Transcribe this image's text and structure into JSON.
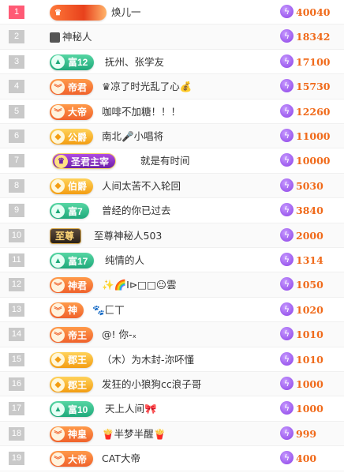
{
  "leaderboard": [
    {
      "rank": "1",
      "badge": {
        "text": "",
        "style": "fire",
        "icon": "crown-icon"
      },
      "name": "焕儿一",
      "score": "40040"
    },
    {
      "rank": "2",
      "badge": null,
      "avatar": "mystery-avatar-icon",
      "name": "神秘人",
      "score": "18342"
    },
    {
      "rank": "3",
      "badge": {
        "text": "富12",
        "style": "green",
        "icon": "triangle-icon"
      },
      "name": "抚州、张学友",
      "score": "17100"
    },
    {
      "rank": "4",
      "badge": {
        "text": "帝君",
        "style": "orange",
        "icon": "chevron-icon"
      },
      "name": "♛凉了时光乱了心💰",
      "score": "15730"
    },
    {
      "rank": "5",
      "badge": {
        "text": "大帝",
        "style": "orange",
        "icon": "chevron-icon"
      },
      "name": "咖啡不加糖！！！",
      "score": "12260"
    },
    {
      "rank": "6",
      "badge": {
        "text": "公爵",
        "style": "gold",
        "icon": "diamond-icon"
      },
      "name": "南北🎤小唱将",
      "score": "11000"
    },
    {
      "rank": "7",
      "badge": {
        "text": "圣君主宰",
        "style": "purple",
        "icon": "crown-icon"
      },
      "name": "就是有时间",
      "score": "10000"
    },
    {
      "rank": "8",
      "badge": {
        "text": "伯爵",
        "style": "gold",
        "icon": "diamond-icon"
      },
      "name": "人间太苦不入轮回",
      "score": "5030"
    },
    {
      "rank": "9",
      "badge": {
        "text": "富7",
        "style": "green",
        "icon": "triangle-icon"
      },
      "name": "曾经的你已过去",
      "score": "3840"
    },
    {
      "rank": "10",
      "badge": {
        "text": "至尊",
        "style": "dark",
        "icon": ""
      },
      "name": "至尊神秘人503",
      "score": "2000"
    },
    {
      "rank": "11",
      "badge": {
        "text": "富17",
        "style": "green",
        "icon": "triangle-icon"
      },
      "name": "纯情的人",
      "score": "1314"
    },
    {
      "rank": "12",
      "badge": {
        "text": "神君",
        "style": "orange",
        "icon": "chevron-icon"
      },
      "name": "✨🌈I⊳□□😐雲",
      "score": "1050"
    },
    {
      "rank": "13",
      "badge": {
        "text": "神",
        "style": "orange",
        "icon": "chevron-icon"
      },
      "name": "🐾匚丅",
      "score": "1020"
    },
    {
      "rank": "14",
      "badge": {
        "text": "帝王",
        "style": "orange",
        "icon": "chevron-icon"
      },
      "name": "@! 你-ₓ",
      "score": "1010"
    },
    {
      "rank": "15",
      "badge": {
        "text": "郡王",
        "style": "gold",
        "icon": "diamond-icon"
      },
      "name": "（木）为木封-沵吥懂",
      "score": "1010"
    },
    {
      "rank": "16",
      "badge": {
        "text": "郡王",
        "style": "gold",
        "icon": "diamond-icon"
      },
      "name": "发狂的小狼狗cc浪子哥",
      "score": "1000"
    },
    {
      "rank": "17",
      "badge": {
        "text": "富10",
        "style": "green",
        "icon": "triangle-icon"
      },
      "name": "天上人间🎀",
      "score": "1000"
    },
    {
      "rank": "18",
      "badge": {
        "text": "神皇",
        "style": "orange",
        "icon": "chevron-icon"
      },
      "name": "🍟半梦半醒🍟",
      "score": "999"
    },
    {
      "rank": "19",
      "badge": {
        "text": "大帝",
        "style": "orange",
        "icon": "chevron-icon"
      },
      "name": "CAT大帝",
      "score": "400"
    }
  ],
  "colors": {
    "top_rank": "#ff5a75",
    "rank": "#c9c9c9",
    "score": "#f06a1a",
    "lightning": "#8a3fe6"
  },
  "score_icon": "lightning-icon"
}
